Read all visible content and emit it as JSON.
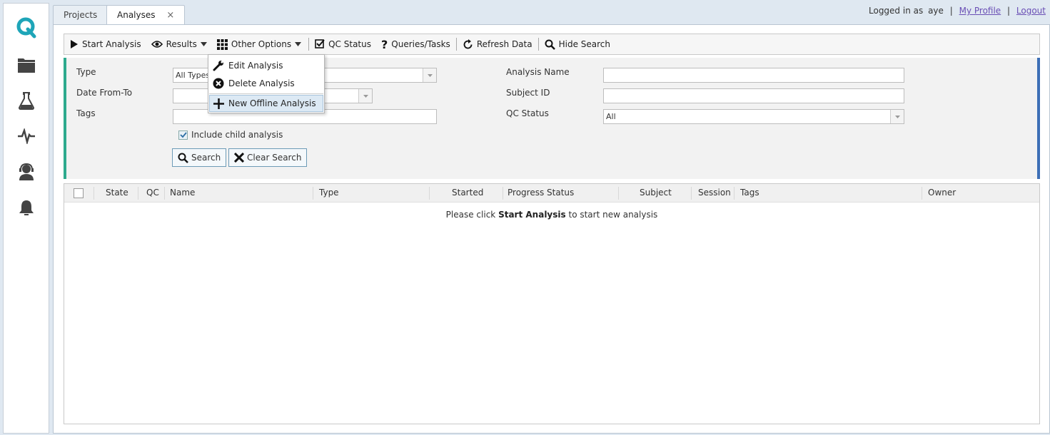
{
  "tabs": [
    {
      "label": "Projects"
    },
    {
      "label": "Analyses",
      "close": "×"
    }
  ],
  "user": {
    "logged_in_prefix": "Logged in as",
    "username": "aye",
    "sep": "|",
    "profile_link": "My Profile",
    "logout_link": "Logout"
  },
  "toolbar": {
    "start_analysis": "Start Analysis",
    "results": "Results",
    "other_options": "Other Options",
    "qc_status": "QC Status",
    "queries_tasks": "Queries/Tasks",
    "refresh_data": "Refresh Data",
    "hide_search": "Hide Search"
  },
  "menu": {
    "edit_analysis": "Edit Analysis",
    "delete_analysis": "Delete Analysis",
    "new_offline_analysis": "New Offline Analysis"
  },
  "search": {
    "type_label": "Type",
    "type_value": "All Types",
    "date_label": "Date From-To",
    "tags_label": "Tags",
    "include_child": "Include child analysis",
    "include_child_checked": true,
    "analysis_name_label": "Analysis Name",
    "subject_id_label": "Subject ID",
    "qc_status_label": "QC Status",
    "qc_status_value": "All",
    "search_button": "Search",
    "clear_button": "Clear Search"
  },
  "grid": {
    "columns": {
      "state": "State",
      "qc": "QC",
      "name": "Name",
      "type": "Type",
      "started": "Started",
      "progress": "Progress Status",
      "subject": "Subject",
      "session": "Session",
      "tags": "Tags",
      "owner": "Owner"
    },
    "empty_prefix": "Please click",
    "empty_bold": "Start Analysis",
    "empty_suffix": "to start new analysis"
  },
  "colors": {
    "accent_teal": "#2eaa8e",
    "accent_blue": "#3d6fb6",
    "link": "#6a4fb5"
  },
  "sidebar_icons": [
    "logo-q-icon",
    "folder-icon",
    "flask-icon",
    "pulse-icon",
    "support-agent-icon",
    "bell-icon"
  ]
}
